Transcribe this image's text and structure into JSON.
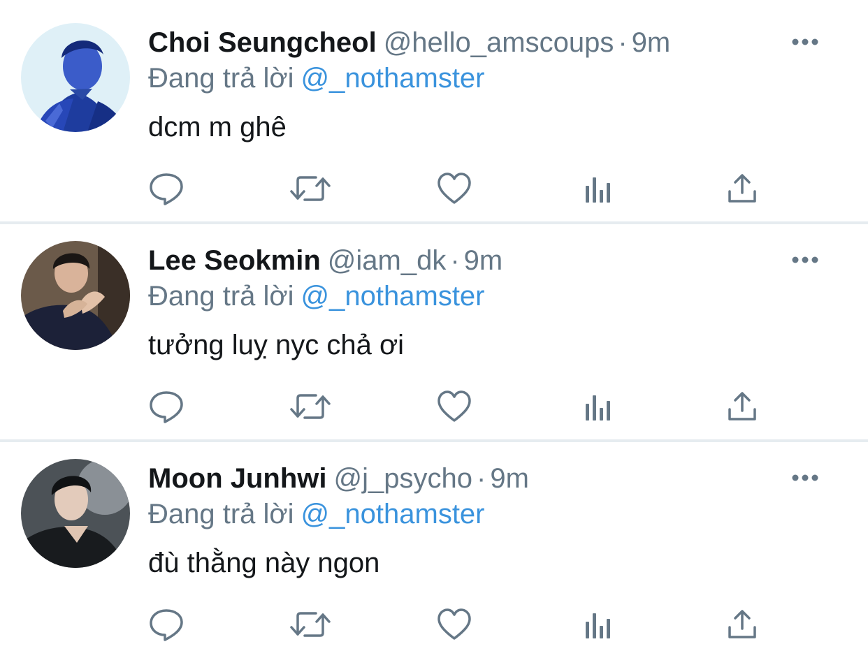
{
  "theme": {
    "text_color": "#14171a",
    "secondary_color": "#657786",
    "link_color": "#3a93dd",
    "icon_color": "#657786",
    "divider_color": "#e6ecf0"
  },
  "tweets": [
    {
      "display_name": "Choi Seungcheol",
      "handle": "@hello_amscoups",
      "separator": "·",
      "time": "9m",
      "reply_prefix": "Đang trả lời",
      "reply_target": "@_nothamster",
      "text": "dcm m ghê",
      "avatar_icon": "avatar-blue-tone-portrait",
      "actions": [
        "reply-icon",
        "retweet-icon",
        "like-icon",
        "stats-icon",
        "share-icon"
      ]
    },
    {
      "display_name": "Lee Seokmin",
      "handle": "@iam_dk",
      "separator": "·",
      "time": "9m",
      "reply_prefix": "Đang trả lời",
      "reply_target": "@_nothamster",
      "text": "tưởng luỵ nyc chả ơi",
      "avatar_icon": "avatar-dark-portrait",
      "actions": [
        "reply-icon",
        "retweet-icon",
        "like-icon",
        "stats-icon",
        "share-icon"
      ]
    },
    {
      "display_name": "Moon Junhwi",
      "handle": "@j_psycho",
      "separator": "·",
      "time": "9m",
      "reply_prefix": "Đang trả lời",
      "reply_target": "@_nothamster",
      "text": "đù thằng này ngon",
      "avatar_icon": "avatar-grey-portrait",
      "actions": [
        "reply-icon",
        "retweet-icon",
        "like-icon",
        "stats-icon",
        "share-icon"
      ]
    }
  ]
}
